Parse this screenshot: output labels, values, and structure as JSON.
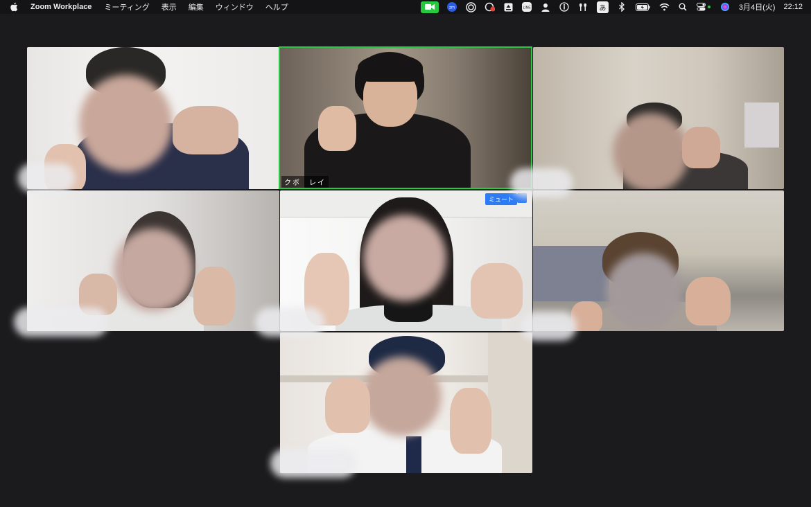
{
  "menubar": {
    "app_name": "Zoom Workplace",
    "menus": [
      "ミーティング",
      "表示",
      "編集",
      "ウィンドウ",
      "ヘルプ"
    ],
    "tray_icons": [
      "zoom-video-icon",
      "zoom-app-icon",
      "screen-record-icon",
      "stats-icon",
      "upload-icon",
      "line-icon",
      "user-icon",
      "accessibility-icon",
      "airpods-icon",
      "input-method-icon",
      "bluetooth-icon",
      "battery-icon",
      "wifi-icon",
      "spotlight-icon",
      "control-center-icon",
      "siri-icon"
    ],
    "input_method": "あ",
    "date": "3月4日(火)",
    "time": "22:12"
  },
  "meeting": {
    "active_speaker_name": "クボ　レイ",
    "mute_label": "ミュート"
  },
  "colors": {
    "active_speaker_border": "#28c840",
    "mute_button": "#2d7cf6"
  }
}
